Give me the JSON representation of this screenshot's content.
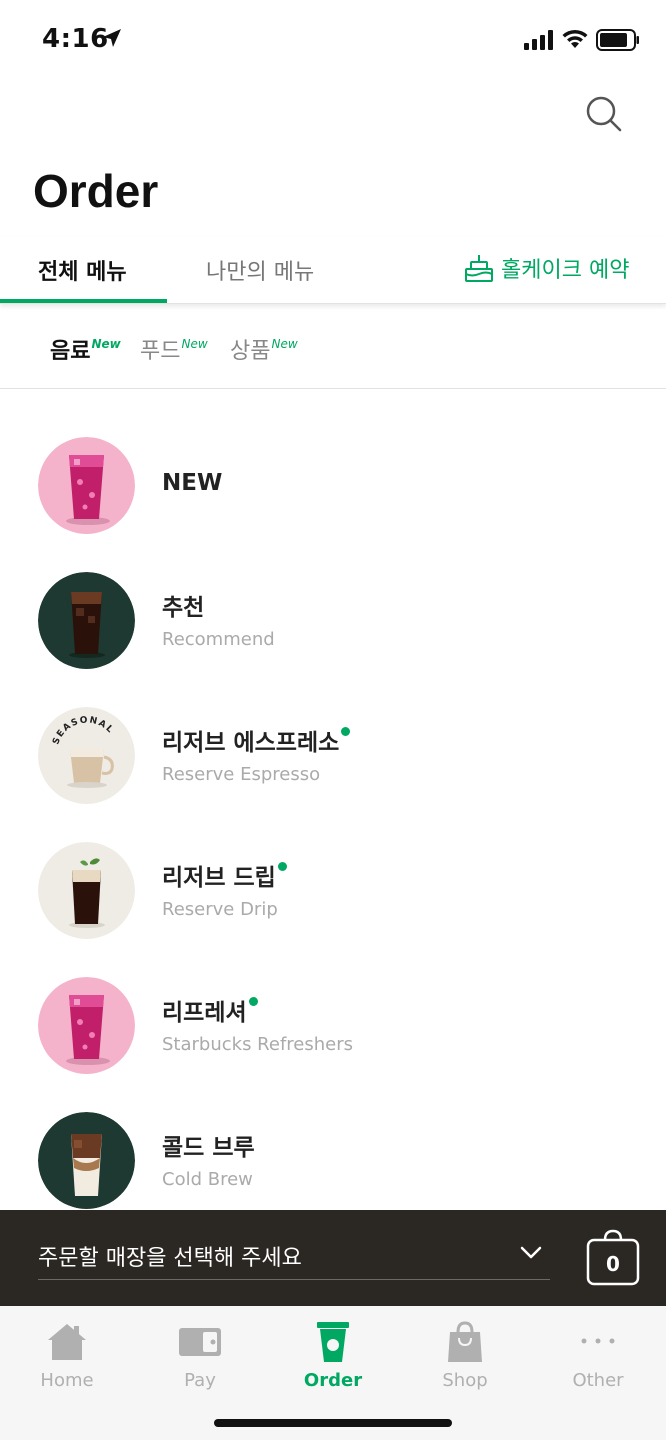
{
  "status_bar": {
    "time": "4:16"
  },
  "header": {
    "title": "Order"
  },
  "tabs": {
    "all_menu": "전체 메뉴",
    "my_menu": "나만의 메뉴",
    "cake_reservation": "홀케이크 예약"
  },
  "subcategories": [
    {
      "label": "음료",
      "badge": "New",
      "selected": true
    },
    {
      "label": "푸드",
      "badge": "New",
      "selected": false
    },
    {
      "label": "상품",
      "badge": "New",
      "selected": false
    }
  ],
  "menu_items": [
    {
      "name_ko": "NEW",
      "name_en": "",
      "new_dot": false,
      "thumb_bg": "#f4b3cb",
      "drink_icon": "pink-drink"
    },
    {
      "name_ko": "추천",
      "name_en": "Recommend",
      "new_dot": false,
      "thumb_bg": "#1e3932",
      "drink_icon": "iced-coffee"
    },
    {
      "name_ko": "리저브 에스프레소",
      "name_en": "Reserve Espresso",
      "new_dot": true,
      "thumb_bg": "#efece6",
      "drink_icon": "latte-cup",
      "thumb_text": "SEASONAL"
    },
    {
      "name_ko": "리저브 드립",
      "name_en": "Reserve Drip",
      "new_dot": true,
      "thumb_bg": "#efece6",
      "drink_icon": "cold-drip"
    },
    {
      "name_ko": "리프레셔",
      "name_en": "Starbucks Refreshers",
      "new_dot": true,
      "thumb_bg": "#f4b3cb",
      "drink_icon": "pink-drink"
    },
    {
      "name_ko": "콜드 브루",
      "name_en": "Cold Brew",
      "new_dot": false,
      "thumb_bg": "#1e3932",
      "drink_icon": "cold-brew-latte"
    }
  ],
  "store_selector": {
    "label": "주문할 매장을 선택해 주세요",
    "cart_count": "0"
  },
  "bottom_nav": [
    {
      "label": "Home",
      "icon": "home-icon",
      "active": false
    },
    {
      "label": "Pay",
      "icon": "card-icon",
      "active": false
    },
    {
      "label": "Order",
      "icon": "cup-icon",
      "active": true
    },
    {
      "label": "Shop",
      "icon": "bag-icon",
      "active": false
    },
    {
      "label": "Other",
      "icon": "more-icon",
      "active": false
    }
  ],
  "colors": {
    "accent": "#00a862",
    "dark_bar": "#2b2723",
    "house_green": "#1e3932"
  }
}
